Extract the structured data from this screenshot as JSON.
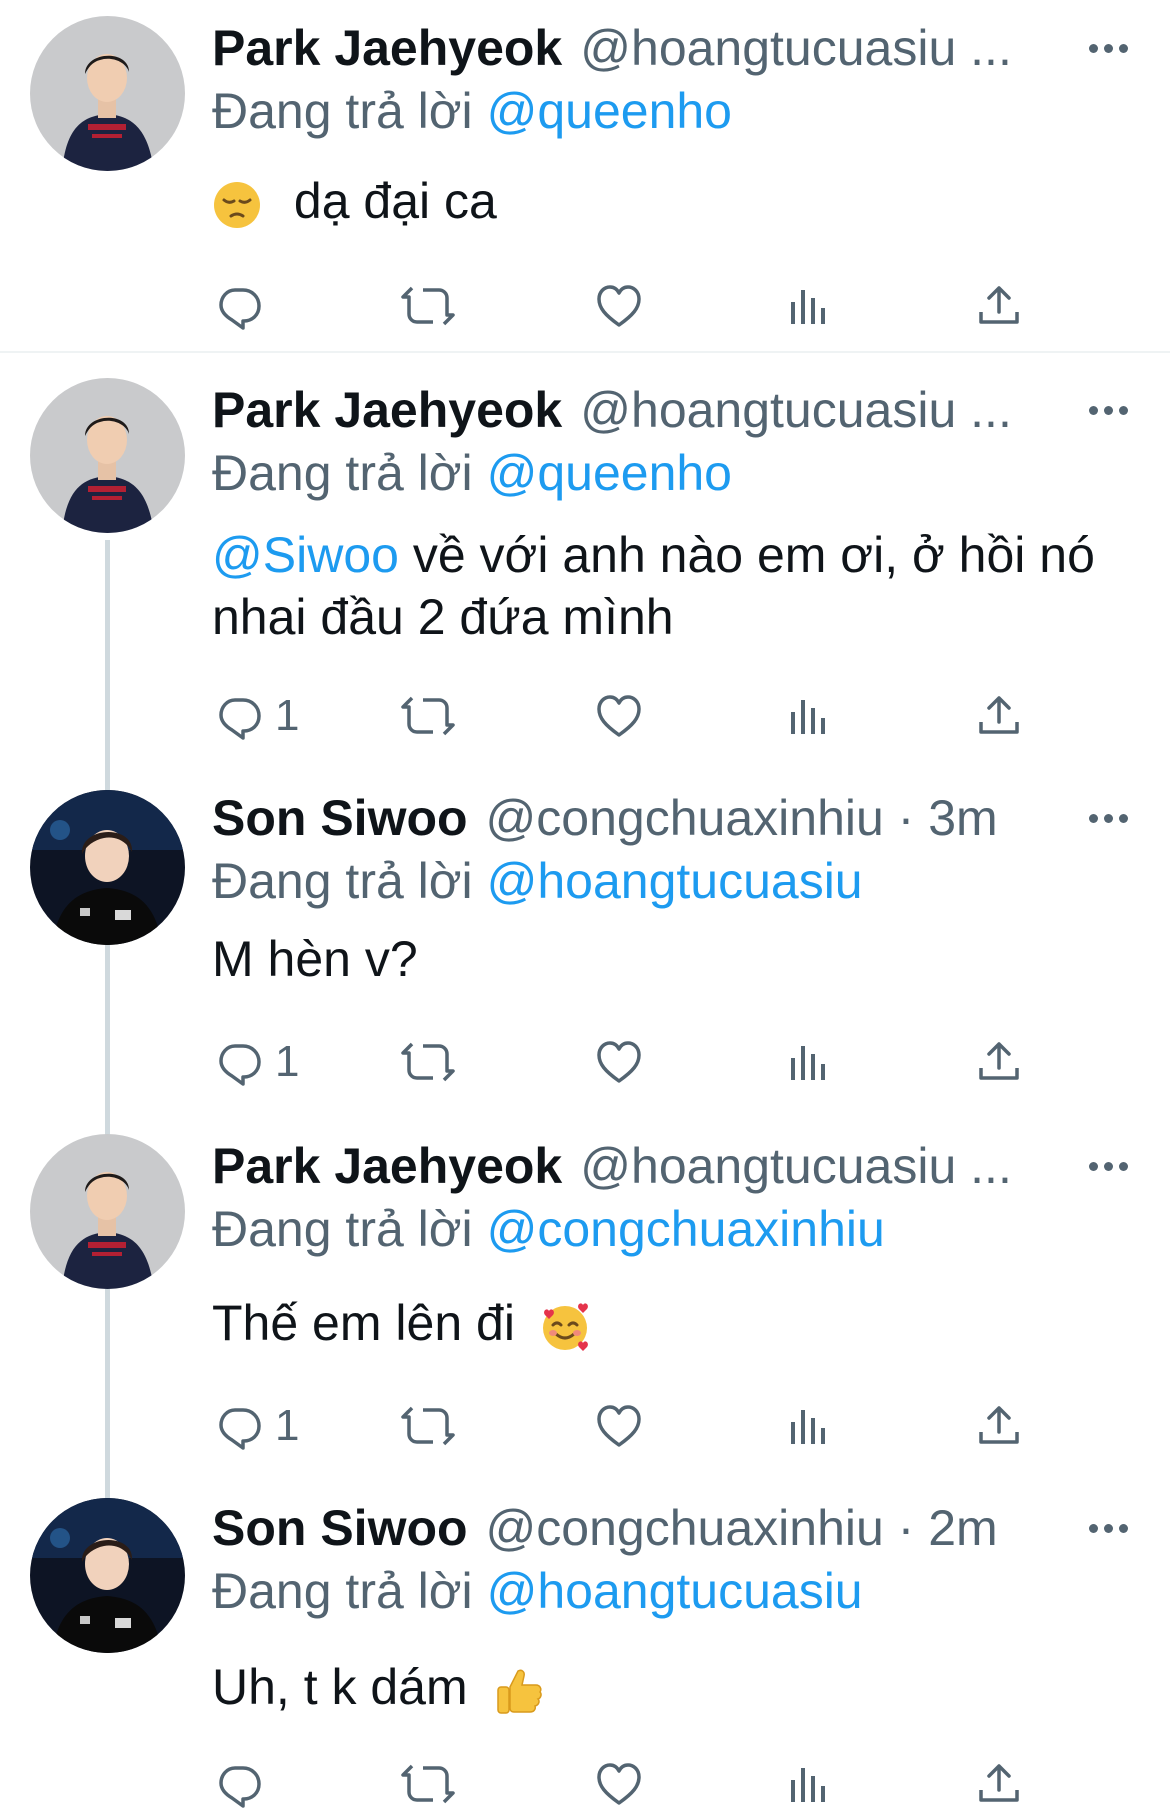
{
  "tweets": [
    {
      "name": "Park Jaehyeok",
      "handle": "@hoangtucuasiu ...",
      "reply_label": "Đang trả lời",
      "reply_to": "@queenho",
      "text": "dạ đại ca",
      "reply_count": ""
    },
    {
      "name": "Park Jaehyeok",
      "handle": "@hoangtucuasiu ...",
      "reply_label": "Đang trả lời",
      "reply_to": "@queenho",
      "text_mention": "@Siwoo",
      "text": " về với anh nào em ơi, ở hồi nó nhai đầu 2 đứa mình",
      "reply_count": "1"
    },
    {
      "name": "Son Siwoo",
      "handle": "@congchuaxinhiu · 3m",
      "reply_label": "Đang trả lời",
      "reply_to": "@hoangtucuasiu",
      "text": "M hèn v?",
      "reply_count": "1"
    },
    {
      "name": "Park Jaehyeok",
      "handle": "@hoangtucuasiu ...",
      "reply_label": "Đang trả lời",
      "reply_to": "@congchuaxinhiu",
      "text": "Thế em lên đi",
      "reply_count": "1"
    },
    {
      "name": "Son Siwoo",
      "handle": "@congchuaxinhiu · 2m",
      "reply_label": "Đang trả lời",
      "reply_to": "@hoangtucuasiu",
      "text": "Uh, t k dám",
      "reply_count": ""
    }
  ],
  "icons": {
    "reply": "reply-icon",
    "retweet": "retweet-icon",
    "like": "heart-icon",
    "views": "views-icon",
    "share": "share-icon",
    "more": "more-icon"
  },
  "colors": {
    "link": "#1d9bf0",
    "secondary": "#536471",
    "thread": "#cfd9de"
  }
}
